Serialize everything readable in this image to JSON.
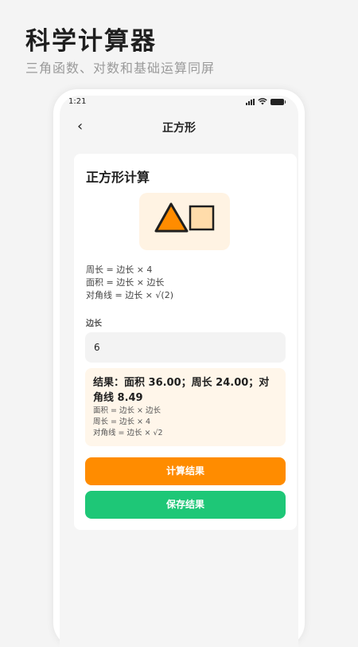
{
  "promo": {
    "title": "科学计算器",
    "subtitle": "三角函数、对数和基础运算同屏"
  },
  "status_bar": {
    "time": "1:21",
    "icons": [
      "signal-icon",
      "wifi-icon",
      "battery-icon"
    ]
  },
  "nav": {
    "back_icon": "chevron-left-icon",
    "back_glyph": "‹",
    "title": "正方形"
  },
  "card": {
    "title": "正方形计算",
    "illustration_icons": [
      "triangle-icon",
      "square-icon"
    ],
    "formulas": [
      "周长 = 边长 × 4",
      "面积 = 边长 × 边长",
      "对角线 = 边长 × √(2)"
    ],
    "field": {
      "label": "边长",
      "value": "6"
    },
    "result": {
      "main": "结果：面积 36.00；周长 24.00；对角线 8.49",
      "lines": [
        "面积 = 边长 × 边长",
        "周长 = 边长 × 4",
        "对角线 = 边长 × √2"
      ]
    },
    "buttons": {
      "calculate": "计算结果",
      "save": "保存结果"
    }
  },
  "colors": {
    "accent_orange": "#ff8c00",
    "accent_green": "#1ec777",
    "triangle_fill": "#ff8c00",
    "square_fill": "#ffdcaa",
    "illustration_bg": "#fff3e3",
    "result_bg": "#fff6ea"
  }
}
